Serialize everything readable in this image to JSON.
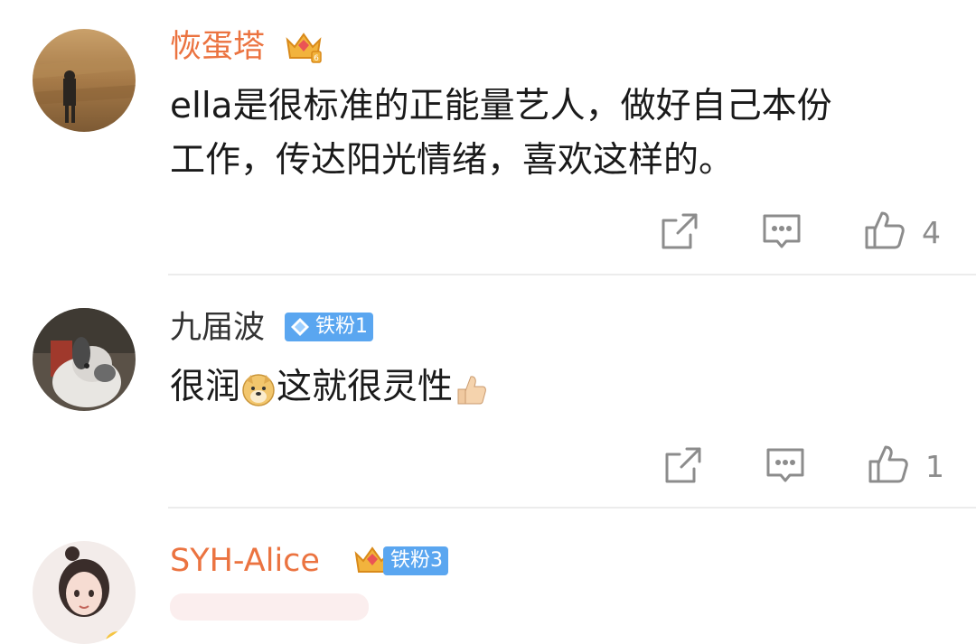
{
  "comments": [
    {
      "username": "恢蛋塔",
      "text_line1": "ella是很标准的正能量艺人，做好自己本份",
      "text_line2": "工作，传达阳光情绪，喜欢这样的。",
      "likes": "4",
      "vip": true,
      "badge": ""
    },
    {
      "username": "九届波",
      "text_part1": "很润",
      "text_part2": "这就很灵性",
      "likes": "1",
      "vip": false,
      "badge": "铁粉1"
    },
    {
      "username": "SYH-Alice",
      "vip": true,
      "badge": "铁粉3"
    }
  ],
  "colors": {
    "vip_name": "#eb7340",
    "normal_name": "#333333",
    "badge_bg": "#5aa6f0",
    "icon_gray": "#8c8c8c"
  },
  "icons": {
    "repost": "repost-icon",
    "comment": "comment-icon",
    "like": "thumbs-up-icon",
    "vip": "crown-icon",
    "fan_badge": "diamond-icon"
  }
}
